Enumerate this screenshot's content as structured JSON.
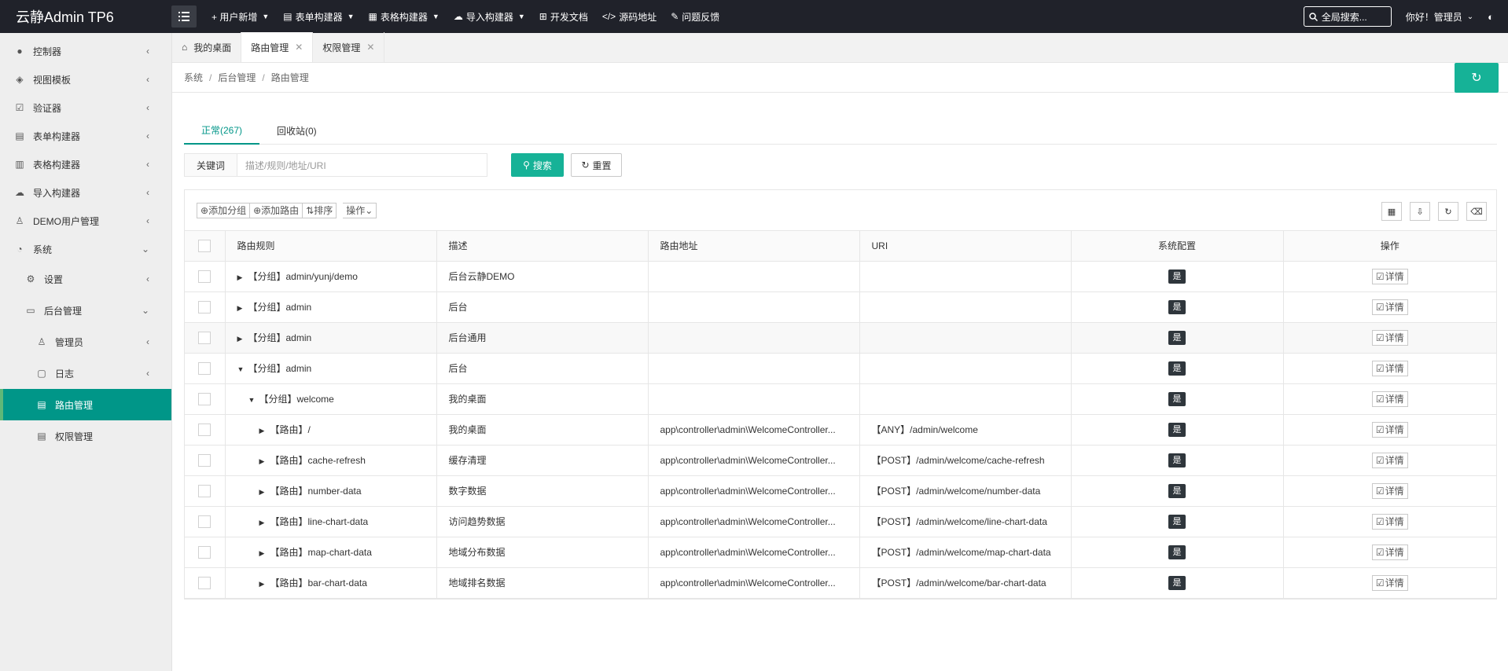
{
  "header": {
    "logo": "云静Admin TP6",
    "nav": [
      {
        "label": "+ 用户新增",
        "caret": true
      },
      {
        "label": "表单构建器",
        "caret": true
      },
      {
        "label": "表格构建器",
        "caret": true
      },
      {
        "label": "导入构建器",
        "caret": true
      },
      {
        "label": "开发文档",
        "caret": false
      },
      {
        "label": "源码地址",
        "caret": false
      },
      {
        "label": "问题反馈",
        "caret": false
      }
    ],
    "search_label": "全局搜索...",
    "user_label": "你好！管理员"
  },
  "sidebar": {
    "items": [
      {
        "label": "控制器"
      },
      {
        "label": "视图模板"
      },
      {
        "label": "验证器"
      },
      {
        "label": "表单构建器"
      },
      {
        "label": "表格构建器"
      },
      {
        "label": "导入构建器"
      },
      {
        "label": "DEMO用户管理"
      },
      {
        "label": "系统"
      },
      {
        "label": "设置"
      },
      {
        "label": "后台管理"
      },
      {
        "label": "管理员"
      },
      {
        "label": "日志"
      },
      {
        "label": "路由管理"
      },
      {
        "label": "权限管理"
      }
    ]
  },
  "tabs": [
    {
      "label": "我的桌面"
    },
    {
      "label": "路由管理"
    },
    {
      "label": "权限管理"
    }
  ],
  "breadcrumb": [
    "系统",
    "后台管理",
    "路由管理"
  ],
  "content_tabs": [
    {
      "label": "正常(267)"
    },
    {
      "label": "回收站(0)"
    }
  ],
  "search": {
    "keyword_label": "关键词",
    "placeholder": "描述/规则/地址/URI",
    "search_button": "搜索",
    "reset_button": "重置"
  },
  "toolbar": {
    "add_group": "添加分组",
    "add_route": "添加路由",
    "sort": "排序",
    "actions": "操作"
  },
  "table": {
    "columns": [
      "路由规则",
      "描述",
      "路由地址",
      "URI",
      "系统配置",
      "操作"
    ],
    "rows": [
      {
        "rule": "【分组】admin/yunj/demo",
        "desc": "后台云静DEMO",
        "addr": "",
        "uri": "",
        "sys": "是",
        "op": "详情"
      },
      {
        "rule": "【分组】admin",
        "desc": "后台",
        "addr": "",
        "uri": "",
        "sys": "是",
        "op": "详情"
      },
      {
        "rule": "【分组】admin",
        "desc": "后台通用",
        "addr": "",
        "uri": "",
        "sys": "是",
        "op": "详情"
      },
      {
        "rule": "【分组】admin",
        "desc": "后台",
        "addr": "",
        "uri": "",
        "sys": "是",
        "op": "详情"
      },
      {
        "rule": "【分组】welcome",
        "desc": "我的桌面",
        "addr": "",
        "uri": "",
        "sys": "是",
        "op": "详情"
      },
      {
        "rule": "【路由】/",
        "desc": "我的桌面",
        "addr": "app\\controller\\admin\\WelcomeController...",
        "uri": "【ANY】/admin/welcome",
        "sys": "是",
        "op": "详情"
      },
      {
        "rule": "【路由】cache-refresh",
        "desc": "缓存清理",
        "addr": "app\\controller\\admin\\WelcomeController...",
        "uri": "【POST】/admin/welcome/cache-refresh",
        "sys": "是",
        "op": "详情"
      },
      {
        "rule": "【路由】number-data",
        "desc": "数字数据",
        "addr": "app\\controller\\admin\\WelcomeController...",
        "uri": "【POST】/admin/welcome/number-data",
        "sys": "是",
        "op": "详情"
      },
      {
        "rule": "【路由】line-chart-data",
        "desc": "访问趋势数据",
        "addr": "app\\controller\\admin\\WelcomeController...",
        "uri": "【POST】/admin/welcome/line-chart-data",
        "sys": "是",
        "op": "详情"
      },
      {
        "rule": "【路由】map-chart-data",
        "desc": "地域分布数据",
        "addr": "app\\controller\\admin\\WelcomeController...",
        "uri": "【POST】/admin/welcome/map-chart-data",
        "sys": "是",
        "op": "详情"
      },
      {
        "rule": "【路由】bar-chart-data",
        "desc": "地域排名数据",
        "addr": "app\\controller\\admin\\WelcomeController...",
        "uri": "【POST】/admin/welcome/bar-chart-data",
        "sys": "是",
        "op": "详情"
      }
    ]
  },
  "colors": {
    "accent": "#009688",
    "button": "#16b297",
    "header": "#20222a"
  }
}
